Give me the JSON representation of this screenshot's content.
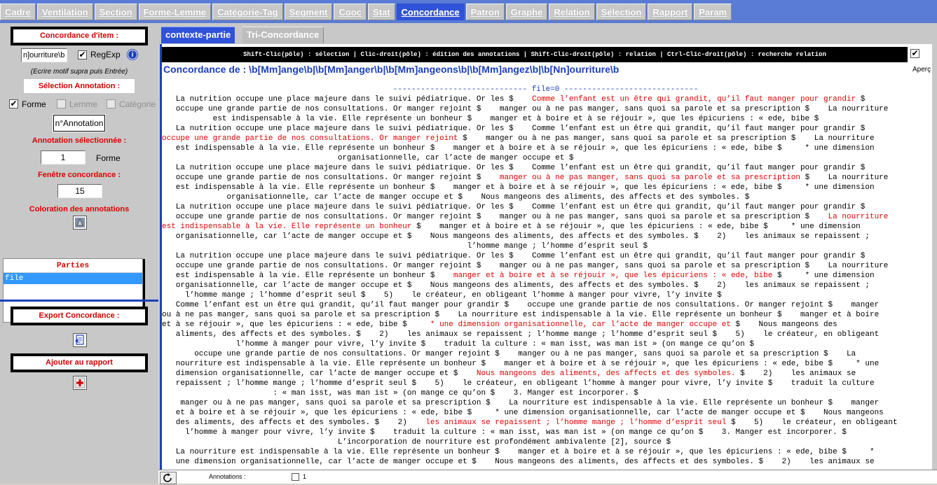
{
  "top_tabs": [
    {
      "label": "Cadre"
    },
    {
      "label": "Ventilation"
    },
    {
      "label": "Section"
    },
    {
      "label": "Forme-Lemme"
    },
    {
      "label": "Catégorie-Tag"
    },
    {
      "label": "Segment"
    },
    {
      "label": "Cooc"
    },
    {
      "label": "Stat"
    },
    {
      "label": "Concordance",
      "active": true
    },
    {
      "label": "Patron"
    },
    {
      "label": "Graphe"
    },
    {
      "label": "Relation"
    },
    {
      "label": "Sélection"
    },
    {
      "label": "Rapport"
    },
    {
      "label": "Param"
    }
  ],
  "left": {
    "concordance_item_title": "Concordance d'item :",
    "pattern_value": "n]ourriture\\b",
    "regexp_label": "RegExp",
    "regexp_checked": "✔",
    "hint": "(Ecrire motif supra puis Entrée)",
    "selection_annotation_title": "Sélection Annotation :",
    "forme_label": "Forme",
    "forme_checked": "✔",
    "lemme_label": "Lemme",
    "categorie_label": "Catégorie",
    "annotation_button": "n°Annotation",
    "annotation_selected_label": "Annotation sélectionnée :",
    "annotation_selected_value": "1",
    "annotation_selected_unit": "Forme",
    "window_label": "Fenêtre concordance :",
    "window_value": "15",
    "coloration_label": "Coloration des annotations",
    "parties_header": "Parties",
    "parties_items": [
      "file"
    ],
    "export_title": "Export Concordance :",
    "add_report_title": "Ajouter au rapport"
  },
  "sub_tabs": [
    {
      "label": "contexte-partie",
      "active": true
    },
    {
      "label": "Tri-Concordance",
      "active": false
    }
  ],
  "info_bar": "Shift-Clic(pôle) : sélection | Clic-droit(pôle) : édition des annotations | Shift-Clic-droit(pôle) : relation | Ctrl-Clic-droit(pôle) : recherche relation",
  "aperc_label": "Aperç",
  "aperc_checked": "✔",
  "concordance_title": "Concordance de : \\b[Mm]ange\\b|\\b[Mm]anger\\b|\\b[Mm]angeons\\b|\\b[Mm]angez\\b|\\b[Nn]ourriture\\b",
  "separator": "----------------------------- file=0 -----------------------------",
  "lines": [
    [
      {
        "t": "   La nutrition occupe une place majeure dans le suivi pédiatrique. Or les $    "
      },
      {
        "t": "Comme l’enfant est un être qui grandit, qu’il faut manger pour grandir",
        "h": true
      },
      {
        "t": " $"
      }
    ],
    [
      {
        "t": "   occupe une grande partie de nos consultations. Or manger rejoint $    manger ou à ne pas manger, sans quoi sa parole et sa prescription $    La nourriture"
      }
    ],
    [
      {
        "t": "           est indispensable à la vie. Elle représente un bonheur $    manger et à boire et à se réjouir », que les épicuriens : « ede, bibe $"
      }
    ],
    [
      {
        "t": "   La nutrition occupe une place majeure dans le suivi pédiatrique. Or les $    Comme l’enfant est un être qui grandit, qu’il faut manger pour grandir $"
      }
    ],
    [
      {
        "t": "occupe une grande partie de nos consultations. Or manger rejoint",
        "h": true
      },
      {
        "t": " $    manger ou à ne pas manger, sans quoi sa parole et sa prescription $    La nourriture"
      }
    ],
    [
      {
        "t": "   est indispensable à la vie. Elle représente un bonheur $    manger et à boire et à se réjouir », que les épicuriens : « ede, bibe $     * une dimension"
      }
    ],
    [
      {
        "t": "                                      organisationnelle, car l’acte de manger occupe et $"
      }
    ],
    [
      {
        "t": "   La nutrition occupe une place majeure dans le suivi pédiatrique. Or les $    Comme l’enfant est un être qui grandit, qu’il faut manger pour grandir $"
      }
    ],
    [
      {
        "t": "   occupe une grande partie de nos consultations. Or manger rejoint $    "
      },
      {
        "t": "manger ou à ne pas manger, sans quoi sa parole et sa prescription",
        "h": true
      },
      {
        "t": " $    La nourriture"
      }
    ],
    [
      {
        "t": "   est indispensable à la vie. Elle représente un bonheur $    manger et à boire et à se réjouir », que les épicuriens : « ede, bibe $     * une dimension"
      }
    ],
    [
      {
        "t": "              organisationnelle, car l’acte de manger occupe et $    Nous mangeons des aliments, des affects et des symboles. $"
      }
    ],
    [
      {
        "t": "   La nutrition occupe une place majeure dans le suivi pédiatrique. Or les $    Comme l’enfant est un être qui grandit, qu’il faut manger pour grandir $"
      }
    ],
    [
      {
        "t": "   occupe une grande partie de nos consultations. Or manger rejoint $    manger ou à ne pas manger, sans quoi sa parole et sa prescription $    "
      },
      {
        "t": "La nourriture",
        "h": true
      }
    ],
    [
      {
        "t": "est indispensable à la vie. Elle représente un bonheur",
        "h": true
      },
      {
        "t": " $    manger et à boire et à se réjouir », que les épicuriens : « ede, bibe $     * une dimension"
      }
    ],
    [
      {
        "t": "   organisationnelle, car l’acte de manger occupe et $    Nous mangeons des aliments, des affects et des symboles. $    2)    les animaux se repaissent ;"
      }
    ],
    [
      {
        "t": "                                                                  l’homme mange ; l’homme d’esprit seul $"
      }
    ],
    [
      {
        "t": "   La nutrition occupe une place majeure dans le suivi pédiatrique. Or les $    Comme l’enfant est un être qui grandit, qu’il faut manger pour grandir $"
      }
    ],
    [
      {
        "t": "   occupe une grande partie de nos consultations. Or manger rejoint $    manger ou à ne pas manger, sans quoi sa parole et sa prescription $    La nourriture"
      }
    ],
    [
      {
        "t": "   est indispensable à la vie. Elle représente un bonheur $    "
      },
      {
        "t": "manger et à boire et à se réjouir », que les épicuriens : « ede, bibe",
        "h": true
      },
      {
        "t": " $     * une dimension"
      }
    ],
    [
      {
        "t": "   organisationnelle, car l’acte de manger occupe et $    Nous mangeons des aliments, des affects et des symboles. $    2)    les animaux se repaissent ;"
      }
    ],
    [
      {
        "t": "     l’homme mange ; l’homme d’esprit seul $    5)    le créateur, en obligeant l’homme à manger pour vivre, l’y invite $"
      }
    ],
    [
      {
        "t": "   Comme l’enfant est un être qui grandit, qu’il faut manger pour grandir $    occupe une grande partie de nos consultations. Or manger rejoint $    manger"
      }
    ],
    [
      {
        "t": "ou à ne pas manger, sans quoi sa parole et sa prescription $    La nourriture est indispensable à la vie. Elle représente un bonheur $    manger et à boire"
      }
    ],
    [
      {
        "t": "et à se réjouir », que les épicuriens : « ede, bibe $     "
      },
      {
        "t": "* une dimension organisationnelle, car l’acte de manger occupe et",
        "h": true
      },
      {
        "t": " $    Nous mangeons des"
      }
    ],
    [
      {
        "t": "   aliments, des affects et des symboles. $    2)    les animaux se repaissent ; l’homme mange ; l’homme d’esprit seul $    5)    le créateur, en obligeant"
      }
    ],
    [
      {
        "t": "                l’homme à manger pour vivre, l’y invite $    traduit la culture : « man isst, was man ist » (on mange ce qu’on $"
      }
    ],
    [
      {
        "t": "       occupe une grande partie de nos consultations. Or manger rejoint $    manger ou à ne pas manger, sans quoi sa parole et sa prescription $    La"
      }
    ],
    [
      {
        "t": "   nourriture est indispensable à la vie. Elle représente un bonheur $    manger et à boire et à se réjouir », que les épicuriens : « ede, bibe $     * une"
      }
    ],
    [
      {
        "t": "   dimension organisationnelle, car l’acte de manger occupe et $    "
      },
      {
        "t": "Nous mangeons des aliments, des affects et des symboles.",
        "h": true
      },
      {
        "t": " $    2)    les animaux se"
      }
    ],
    [
      {
        "t": "   repaissent ; l’homme mange ; l’homme d’esprit seul $    5)    le créateur, en obligeant l’homme à manger pour vivre, l’y invite $    traduit la culture"
      }
    ],
    [
      {
        "t": "                        : « man isst, was man ist » (on mange ce qu’on $    3. Manger est incorporer. $"
      }
    ],
    [
      {
        "t": "    manger ou à ne pas manger, sans quoi sa parole et sa prescription $    La nourriture est indispensable à la vie. Elle représente un bonheur $    manger"
      }
    ],
    [
      {
        "t": "   et à boire et à se réjouir », que les épicuriens : « ede, bibe $     * une dimension organisationnelle, car l’acte de manger occupe et $    Nous mangeons"
      }
    ],
    [
      {
        "t": "   des aliments, des affects et des symboles. $    2)    "
      },
      {
        "t": "les animaux se repaissent ; l’homme mange ; l’homme d’esprit seul",
        "h": true
      },
      {
        "t": " $    5)    le créateur, en obligeant"
      }
    ],
    [
      {
        "t": "     l’homme à manger pour vivre, l’y invite $    traduit la culture : « man isst, was man ist » (on mange ce qu’on $    3. Manger est incorporer. $"
      }
    ],
    [
      {
        "t": "                                      L’incorporation de nourriture est profondément ambivalente [2], source $"
      }
    ],
    [
      {
        "t": "   La nourriture est indispensable à la vie. Elle représente un bonheur $    manger et à boire et à se réjouir », que les épicuriens : « ede, bibe $     *"
      }
    ],
    [
      {
        "t": "   une dimension organisationnelle, car l’acte de manger occupe et $    Nous mangeons des aliments, des affects et des symboles. $    2)    les animaux se"
      }
    ]
  ],
  "bottom": {
    "annotations_label": "Annotations :",
    "annotations_value": "1"
  }
}
